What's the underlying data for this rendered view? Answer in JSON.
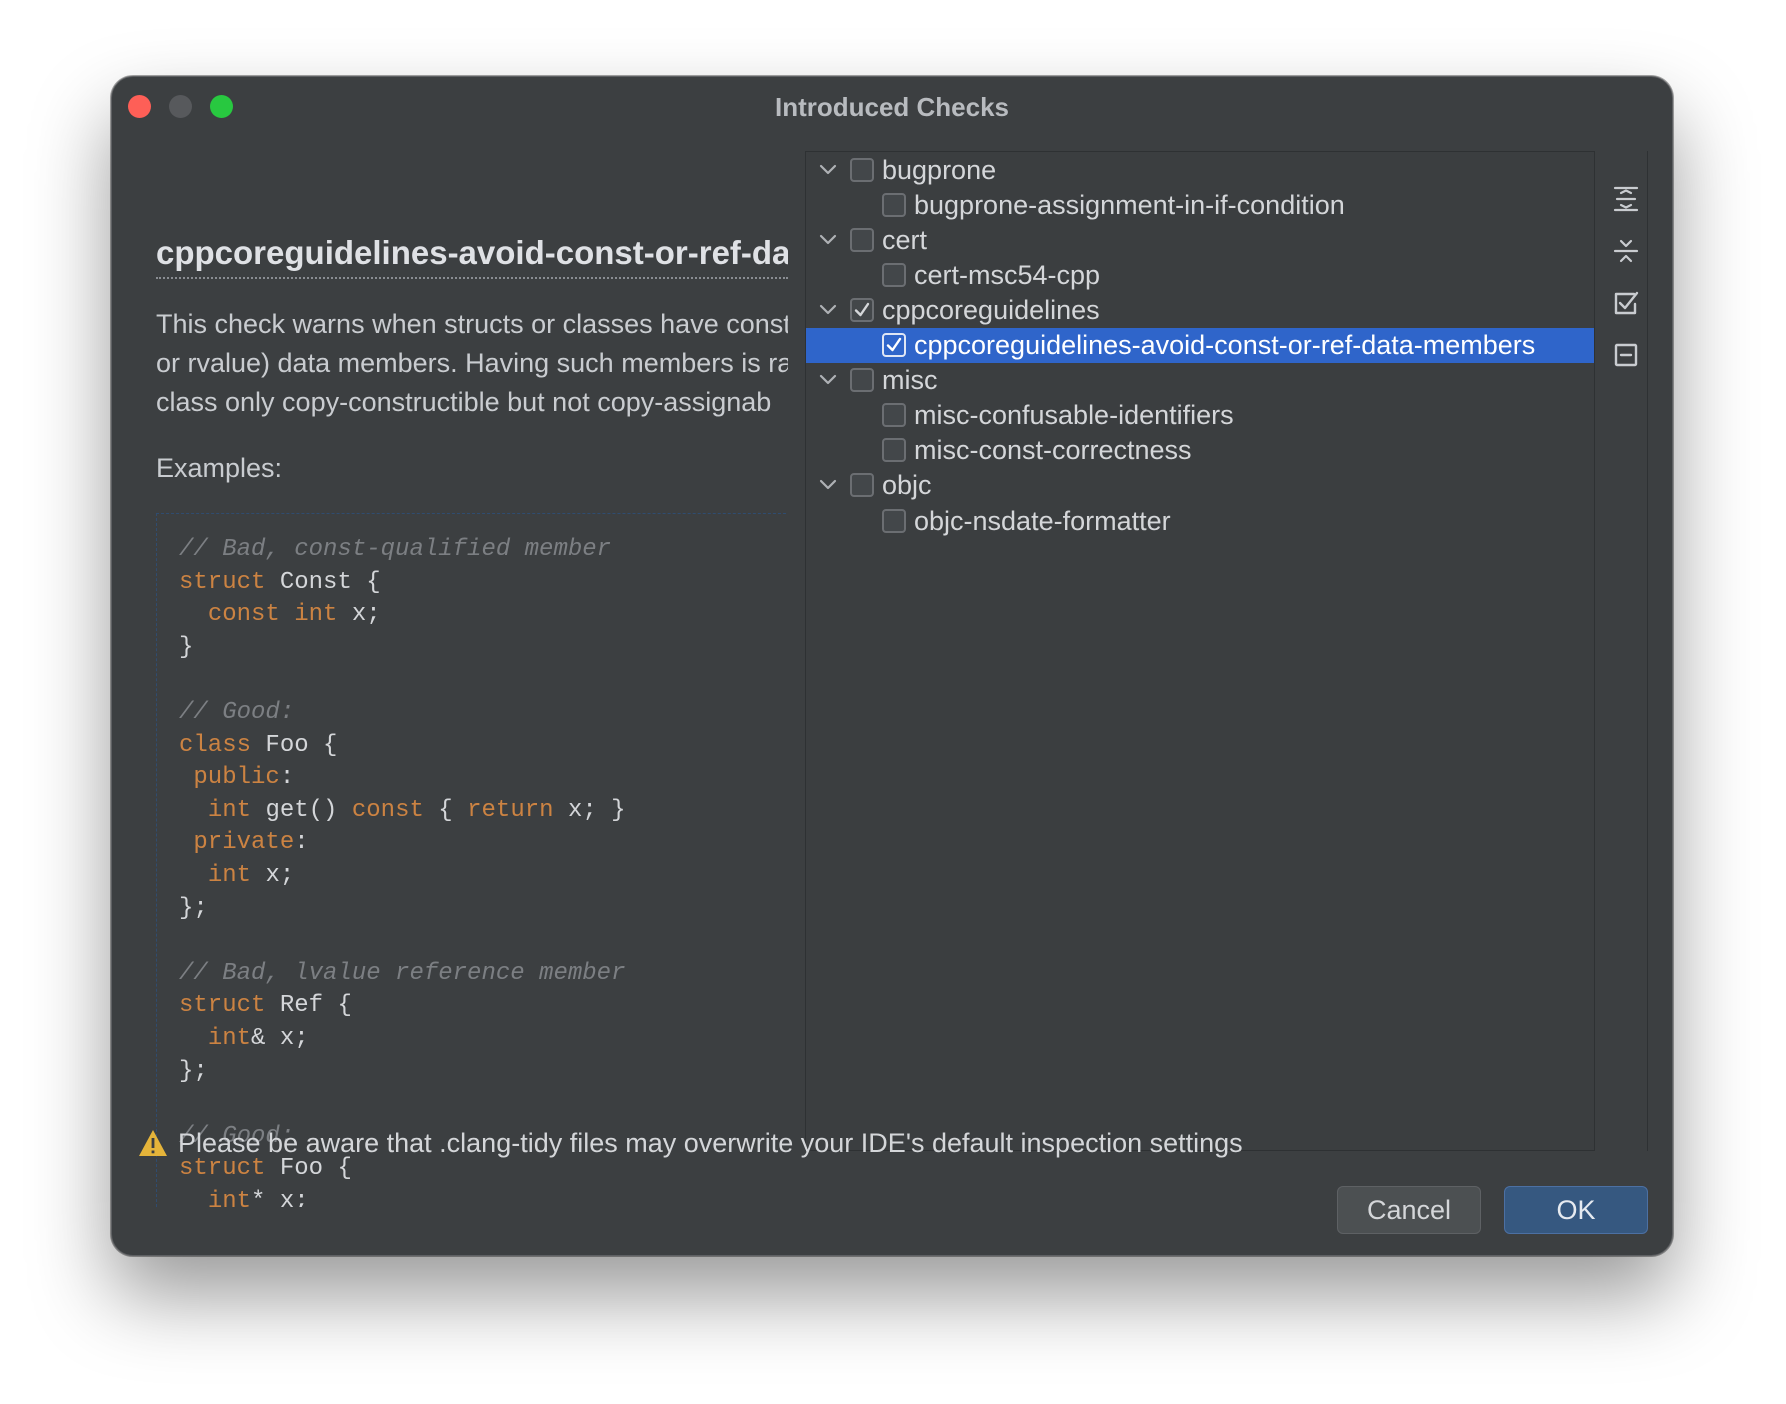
{
  "window": {
    "title": "Introduced Checks"
  },
  "description": {
    "check_name": "cppcoreguidelines-avoid-const-or-ref-data-members",
    "lines": [
      "This check warns when structs or classes have const",
      "or rvalue) data members. Having such members is ra",
      "class only copy-constructible but not copy-assignab"
    ],
    "examples_label": "Examples:",
    "code": [
      "// Bad, const-qualified member",
      "struct Const {",
      "  const int x;",
      "}",
      "",
      "// Good:",
      "class Foo {",
      " public:",
      "  int get() const { return x; }",
      " private:",
      "  int x;",
      "};",
      "",
      "// Bad, lvalue reference member",
      "struct Ref {",
      "  int& x;",
      "};",
      "",
      "// Good:",
      "struct Foo {",
      "  int* x;"
    ]
  },
  "tree": {
    "rows": [
      {
        "label": "bugprone",
        "group": true,
        "expanded": true,
        "checked": false,
        "selected": false
      },
      {
        "label": "bugprone-assignment-in-if-condition",
        "group": false,
        "checked": false,
        "selected": false
      },
      {
        "label": "cert",
        "group": true,
        "expanded": true,
        "checked": false,
        "selected": false
      },
      {
        "label": "cert-msc54-cpp",
        "group": false,
        "checked": false,
        "selected": false
      },
      {
        "label": "cppcoreguidelines",
        "group": true,
        "expanded": true,
        "checked": true,
        "selected": false
      },
      {
        "label": "cppcoreguidelines-avoid-const-or-ref-data-members",
        "group": false,
        "checked": true,
        "selected": true
      },
      {
        "label": "misc",
        "group": true,
        "expanded": true,
        "checked": false,
        "selected": false
      },
      {
        "label": "misc-confusable-identifiers",
        "group": false,
        "checked": false,
        "selected": false
      },
      {
        "label": "misc-const-correctness",
        "group": false,
        "checked": false,
        "selected": false
      },
      {
        "label": "objc",
        "group": true,
        "expanded": true,
        "checked": false,
        "selected": false
      },
      {
        "label": "objc-nsdate-formatter",
        "group": false,
        "checked": false,
        "selected": false
      }
    ]
  },
  "toolbar": {
    "icons": [
      "expand-all-icon",
      "collapse-all-icon",
      "check-all-icon",
      "uncheck-all-icon"
    ]
  },
  "warning": {
    "icon": "warning-icon",
    "text": "Please be aware that .clang-tidy files may overwrite your IDE's default inspection settings"
  },
  "buttons": {
    "cancel_label": "Cancel",
    "ok_label": "OK"
  },
  "colors": {
    "background": "#3c3f41",
    "selection": "#2f65ca",
    "keyword": "#cc8342",
    "comment": "#7c7f83",
    "ok_button": "#365880"
  }
}
